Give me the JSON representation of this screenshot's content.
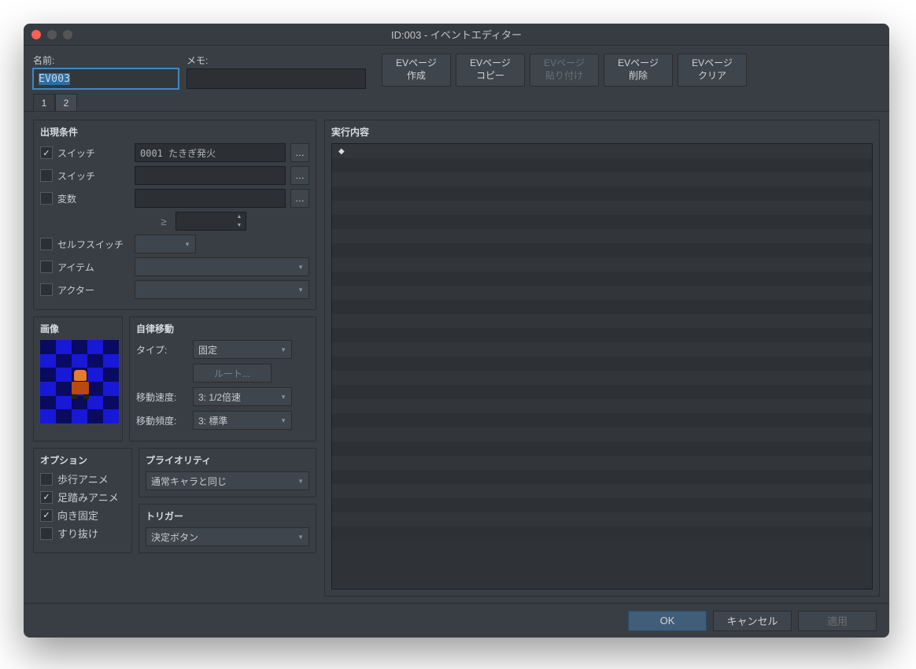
{
  "window": {
    "title": "ID:003 - イベントエディター"
  },
  "header": {
    "name_label": "名前:",
    "name_value": "EV003",
    "memo_label": "メモ:",
    "memo_value": ""
  },
  "page_buttons": {
    "create": "EVページ\n作成",
    "copy": "EVページ\nコピー",
    "paste": "EVページ\n貼り付け",
    "delete": "EVページ\n削除",
    "clear": "EVページ\nクリア"
  },
  "tabs": [
    "1",
    "2"
  ],
  "conditions": {
    "title": "出現条件",
    "switch1_label": "スイッチ",
    "switch1_checked": true,
    "switch1_value": "0001 たきぎ発火",
    "switch2_label": "スイッチ",
    "switch2_checked": false,
    "switch2_value": "",
    "variable_label": "変数",
    "variable_checked": false,
    "variable_value": "",
    "variable_op": "≥",
    "variable_num": "",
    "selfswitch_label": "セルフスイッチ",
    "selfswitch_checked": false,
    "selfswitch_value": "",
    "item_label": "アイテム",
    "item_checked": false,
    "item_value": "",
    "actor_label": "アクター",
    "actor_checked": false,
    "actor_value": ""
  },
  "image": {
    "title": "画像"
  },
  "automove": {
    "title": "自律移動",
    "type_label": "タイプ:",
    "type_value": "固定",
    "route_label": "ルート...",
    "speed_label": "移動速度:",
    "speed_value": "3: 1/2倍速",
    "freq_label": "移動頻度:",
    "freq_value": "3: 標準"
  },
  "options": {
    "title": "オプション",
    "walk_anim": {
      "label": "歩行アニメ",
      "checked": false
    },
    "step_anim": {
      "label": "足踏みアニメ",
      "checked": true
    },
    "dir_fix": {
      "label": "向き固定",
      "checked": true
    },
    "through": {
      "label": "すり抜け",
      "checked": false
    }
  },
  "priority": {
    "title": "プライオリティ",
    "value": "通常キャラと同じ"
  },
  "trigger": {
    "title": "トリガー",
    "value": "決定ボタン"
  },
  "exec": {
    "title": "実行内容",
    "rows": [
      "◆"
    ]
  },
  "bottom": {
    "ok": "OK",
    "cancel": "キャンセル",
    "apply": "適用"
  }
}
